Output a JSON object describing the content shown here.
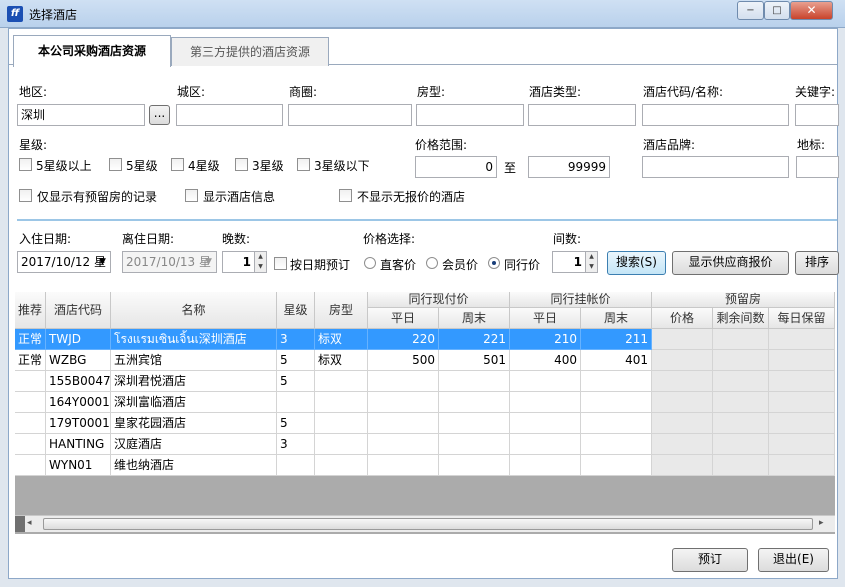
{
  "window": {
    "title": "选择酒店",
    "icon_letter": "ff",
    "minimize": "−",
    "maximize": "□",
    "close": "✕"
  },
  "tabs": [
    {
      "label": "本公司采购酒店资源"
    },
    {
      "label": "第三方提供的酒店资源"
    }
  ],
  "filters": {
    "region_label": "地区:",
    "region_value": "深圳",
    "browse_label": "...",
    "district_label": "城区:",
    "business_area_label": "商圈:",
    "room_type_label": "房型:",
    "hotel_type_label": "酒店类型:",
    "hotel_code_label": "酒店代码/名称:",
    "keyword_label": "关键字:",
    "star_label": "星级:",
    "stars": [
      "5星级以上",
      "5星级",
      "4星级",
      "3星级",
      "3星级以下"
    ],
    "price_range_label": "价格范围:",
    "price_min": "0",
    "price_to": "至",
    "price_max": "99999",
    "brand_label": "酒店品牌:",
    "landmark_label": "地标:",
    "only_reserved": "仅显示有预留房的记录",
    "show_hotel_info": "显示酒店信息",
    "hide_no_price": "不显示无报价的酒店"
  },
  "booking": {
    "checkin_label": "入住日期:",
    "checkin_value": "2017/10/12 星",
    "checkout_label": "离住日期:",
    "checkout_value": "2017/10/13 星",
    "nights_label": "晚数:",
    "nights_value": "1",
    "by_date_label": "按日期预订",
    "price_select_label": "价格选择:",
    "price_options": [
      "直客价",
      "会员价",
      "同行价"
    ],
    "rooms_label": "间数:",
    "rooms_value": "1",
    "search_button": "搜索(S)",
    "show_supplier_button": "显示供应商报价",
    "sort_button": "排序"
  },
  "table": {
    "headers": {
      "recommend": "推荐",
      "code": "酒店代码",
      "name": "名称",
      "star": "星级",
      "room_type": "房型",
      "peer_cash": "同行现付价",
      "peer_credit": "同行挂帐价",
      "reserved": "预留房",
      "weekday": "平日",
      "weekend": "周末",
      "price": "价格",
      "remaining": "剩余间数",
      "daily_hold": "每日保留"
    },
    "rows": [
      {
        "rec": "正常",
        "code": "TWJD",
        "name": "โรงแรมเซินเจิ้นเ深圳酒店",
        "star": "3",
        "room": "标双",
        "cw": "220",
        "ce": "221",
        "gw": "210",
        "ge": "211"
      },
      {
        "rec": "正常",
        "code": "WZBG",
        "name": "五洲宾馆",
        "star": "5",
        "room": "标双",
        "cw": "500",
        "ce": "501",
        "gw": "400",
        "ge": "401"
      },
      {
        "rec": "",
        "code": "155B0047",
        "name": "深圳君悦酒店",
        "star": "5",
        "room": "",
        "cw": "",
        "ce": "",
        "gw": "",
        "ge": ""
      },
      {
        "rec": "",
        "code": "164Y0001",
        "name": "深圳富临酒店",
        "star": "",
        "room": "",
        "cw": "",
        "ce": "",
        "gw": "",
        "ge": ""
      },
      {
        "rec": "",
        "code": "179T0001",
        "name": "皇家花园酒店",
        "star": "5",
        "room": "",
        "cw": "",
        "ce": "",
        "gw": "",
        "ge": ""
      },
      {
        "rec": "",
        "code": "HANTING",
        "name": "汉庭酒店",
        "star": "3",
        "room": "",
        "cw": "",
        "ce": "",
        "gw": "",
        "ge": ""
      },
      {
        "rec": "",
        "code": "WYN01",
        "name": "维也纳酒店",
        "star": "",
        "room": "",
        "cw": "",
        "ce": "",
        "gw": "",
        "ge": ""
      }
    ]
  },
  "footer": {
    "book_button": "预订",
    "exit_button": "退出(E)"
  }
}
